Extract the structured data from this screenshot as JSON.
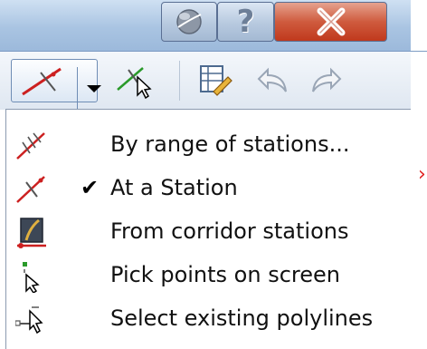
{
  "window": {
    "orb_icon": "info-center-orb-icon",
    "help_label": "?",
    "close_icon": "close-icon"
  },
  "toolbar": {
    "split_button_icon": "sample-lines-icon",
    "dropdown_arrow_icon": "chevron-down-icon",
    "pick_icon": "pick-sample-line-icon",
    "edit_icon": "edit-table-icon",
    "undo_icon": "undo-icon",
    "redo_icon": "redo-icon"
  },
  "menu": {
    "items": [
      {
        "label": "By range of stations...",
        "checked": false,
        "icon": "range-of-stations-icon"
      },
      {
        "label": "At a Station",
        "checked": true,
        "check_glyph": "✔",
        "icon": "at-station-icon"
      },
      {
        "label": "From corridor stations",
        "checked": false,
        "icon": "corridor-stations-icon"
      },
      {
        "label": "Pick points on screen",
        "checked": false,
        "icon": "pick-points-icon"
      },
      {
        "label": "Select existing polylines",
        "checked": false,
        "icon": "existing-polylines-icon"
      }
    ]
  },
  "colors": {
    "title_bar": "#a9c4e2",
    "close_button": "#c9442a",
    "accent_red": "#cc2020",
    "accent_green": "#2a9a2a"
  }
}
